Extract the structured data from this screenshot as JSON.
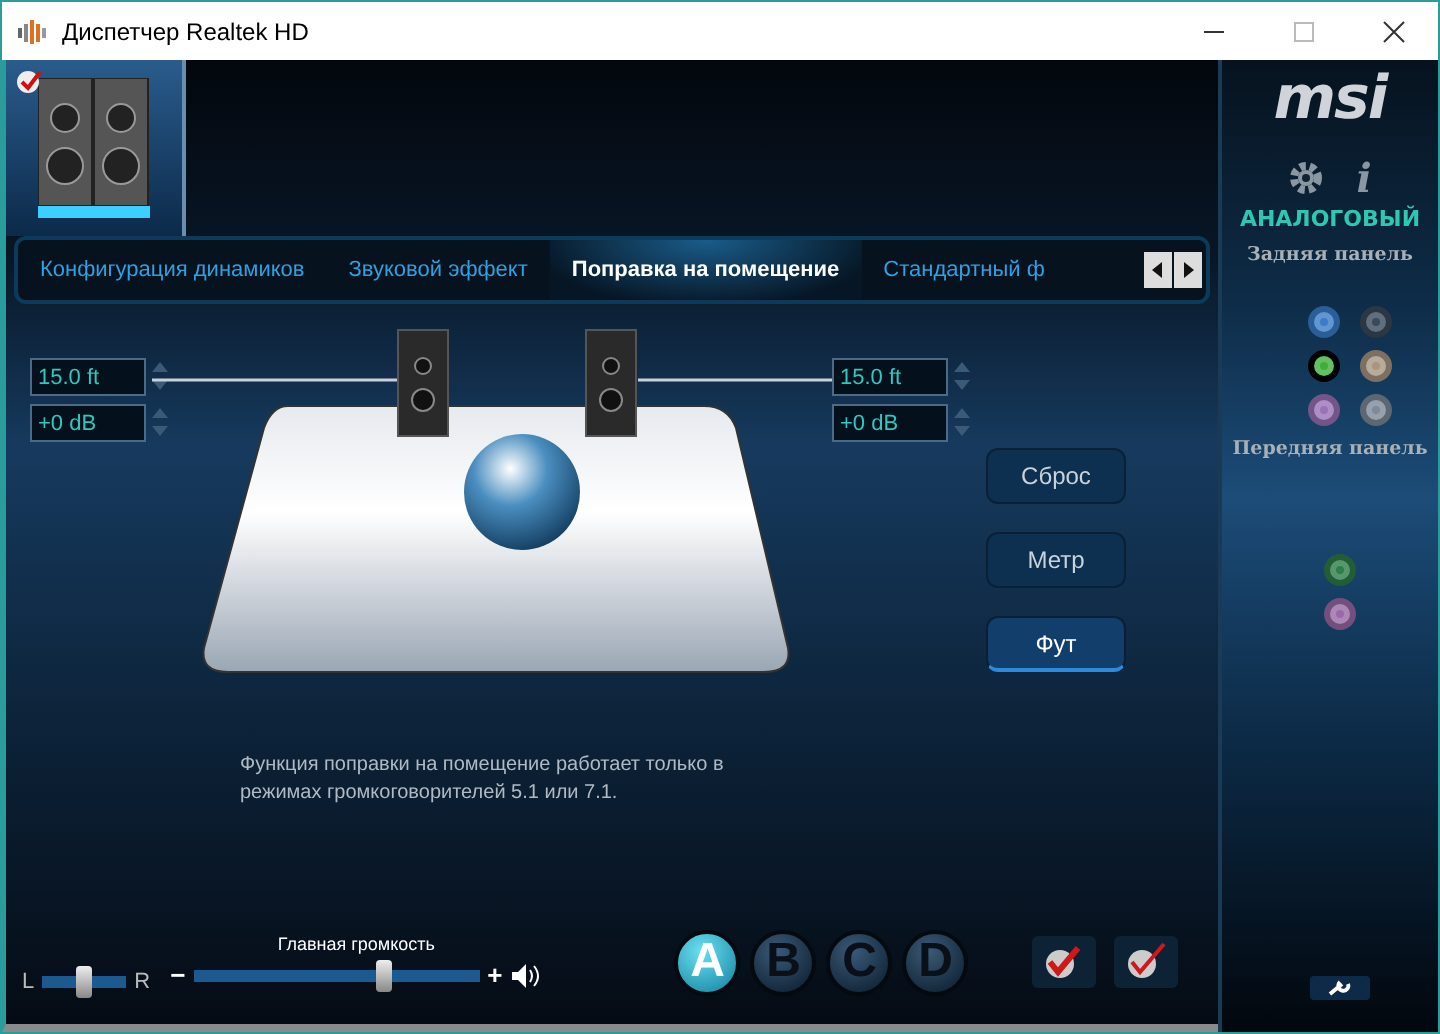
{
  "window": {
    "title": "Диспетчер Realtek HD"
  },
  "device": {
    "checked": true
  },
  "tabs": [
    {
      "label": "Конфигурация динамиков",
      "selected": false
    },
    {
      "label": "Звуковой эффект",
      "selected": false
    },
    {
      "label": "Поправка на помещение",
      "selected": true
    },
    {
      "label": "Стандартный ф",
      "selected": false
    }
  ],
  "room": {
    "left": {
      "distance": "15.0 ft",
      "gain": "+0 dB"
    },
    "right": {
      "distance": "15.0 ft",
      "gain": "+0 dB"
    },
    "note": "Функция поправки на помещение работает только в режимах громкоговорителей 5.1 или 7.1."
  },
  "unit_buttons": [
    {
      "label": "Сброс",
      "selected": false
    },
    {
      "label": "Метр",
      "selected": false
    },
    {
      "label": "Фут",
      "selected": true
    }
  ],
  "balance": {
    "left_label": "L",
    "right_label": "R",
    "level": 0.5
  },
  "volume": {
    "label": "Главная громкость",
    "minus": "−",
    "plus": "+",
    "level": 0.67
  },
  "profiles": [
    {
      "label": "A",
      "selected": true
    },
    {
      "label": "B",
      "selected": false
    },
    {
      "label": "C",
      "selected": false
    },
    {
      "label": "D",
      "selected": false
    }
  ],
  "side_panel": {
    "logo": "msi",
    "info": "i",
    "mode": "АНАЛОГОВЫЙ",
    "rear_label": "Задняя панель",
    "rear_jacks": [
      {
        "color": "#3a7cc8",
        "active": false
      },
      {
        "color": "#3a4a5a",
        "active": false
      },
      {
        "color": "#3fae3a",
        "active": true
      },
      {
        "color": "#a89680",
        "active": false
      },
      {
        "color": "#9a72b8",
        "active": false
      },
      {
        "color": "#7d8a98",
        "active": false
      }
    ],
    "front_label": "Передняя панель",
    "front_jacks": [
      {
        "color": "#2f7d4a",
        "active": false
      },
      {
        "color": "#9a6aa8",
        "active": false
      }
    ]
  }
}
